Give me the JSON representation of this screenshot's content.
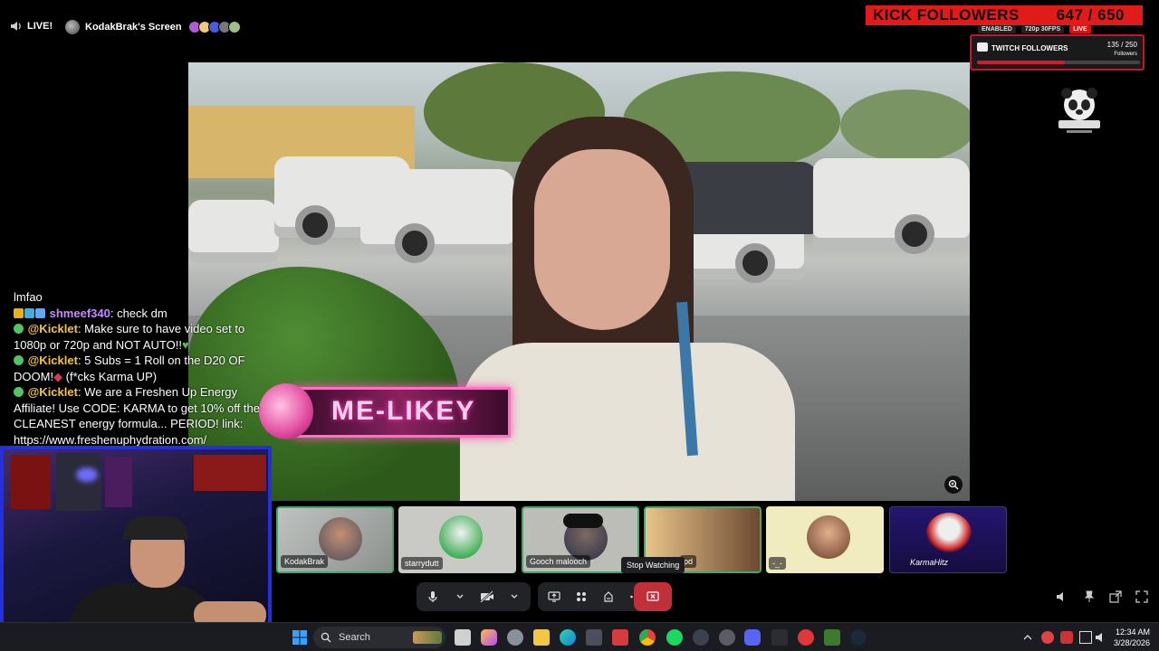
{
  "header": {
    "live_label": "LIVE!",
    "screen_title": "KodakBrak's Screen"
  },
  "kick_followers": {
    "label": "KICK FOLLOWERS",
    "count": "647 / 650"
  },
  "status_chips": [
    "ENABLED",
    "720p 30FPS",
    "LIVE"
  ],
  "twitch_followers": {
    "label": "TWITCH FOLLOWERS",
    "count": "135 / 250",
    "sub": "Followers",
    "progress": 0.54
  },
  "overlay": {
    "me_likey": "ME-LIKEY"
  },
  "chat": [
    {
      "user": "",
      "text": "lmfao"
    },
    {
      "user": "shmeef340",
      "text": ": check dm"
    },
    {
      "user": "@Kicklet",
      "text": ": Make sure to have video set to 1080p or 720p and NOT AUTO!!"
    },
    {
      "user": "@Kicklet",
      "text": ": 5 Subs = 1 Roll on the D20 OF DOOM!"
    },
    {
      "user": "",
      "text": " (f*cks Karma UP)"
    },
    {
      "user": "@Kicklet",
      "text": ": We are a Freshen Up Energy Affiliate! Use CODE: KARMA to get 10% off the CLEANEST energy formula... PERIOD! link: https://www.freshenuphydration.com/"
    }
  ],
  "participants": [
    {
      "name": "KodakBrak"
    },
    {
      "name": "starrydutt"
    },
    {
      "name": "Gooch malooch"
    },
    {
      "name": "pd"
    },
    {
      "name": "-_-"
    },
    {
      "name": "KarmaHitz"
    }
  ],
  "tooltip": {
    "stop_watching": "Stop Watching"
  },
  "taskbar": {
    "search_label": "Search",
    "time": "12:34 AM",
    "date": "3/28/2026"
  },
  "colors": {
    "kick_red": "#e11a1a",
    "twitch_red": "#d21b2c",
    "stop_red": "#c0303a",
    "webcam_border": "#2430e0",
    "tile_active": "#3fa86a",
    "me_likey_pink": "#ff6ec7"
  },
  "icons": [
    "speaker-icon",
    "zoom-icon",
    "mic-icon",
    "camera-off-icon",
    "screen-share-icon",
    "activities-icon",
    "soundboard-icon",
    "more-icon",
    "stop-watching-icon",
    "volume-icon",
    "pin-icon",
    "popout-icon",
    "fullscreen-icon",
    "windows-start-icon",
    "search-icon"
  ]
}
